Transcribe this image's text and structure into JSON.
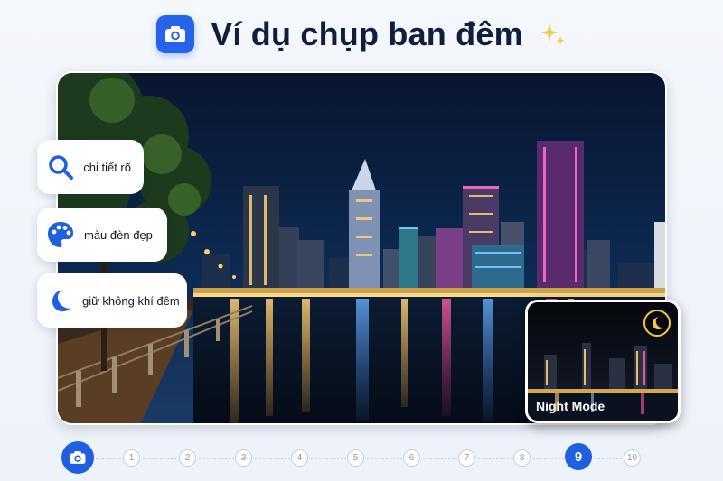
{
  "header": {
    "title": "Ví dụ chụp ban đêm",
    "icon": "camera-icon",
    "sparkle_icon": "sparkle-icon"
  },
  "photo": {
    "description_icon": "night-city-photo"
  },
  "features": [
    {
      "label": "chi tiết rõ",
      "icon": "search-icon"
    },
    {
      "label": "màu đèn đẹp",
      "icon": "palette-icon"
    },
    {
      "label": "giữ không khí đêm",
      "icon": "moon-icon"
    }
  ],
  "inset": {
    "label": "Night Mode",
    "icon": "moon-icon"
  },
  "stepper": {
    "steps": [
      "1",
      "2",
      "3",
      "4",
      "5",
      "6",
      "7",
      "8",
      "9",
      "10"
    ],
    "active": "9",
    "start_icon": "camera-icon"
  },
  "colors": {
    "accent": "#1f5fe0",
    "title": "#0f1f3d",
    "sparkle": "#f6c744"
  }
}
